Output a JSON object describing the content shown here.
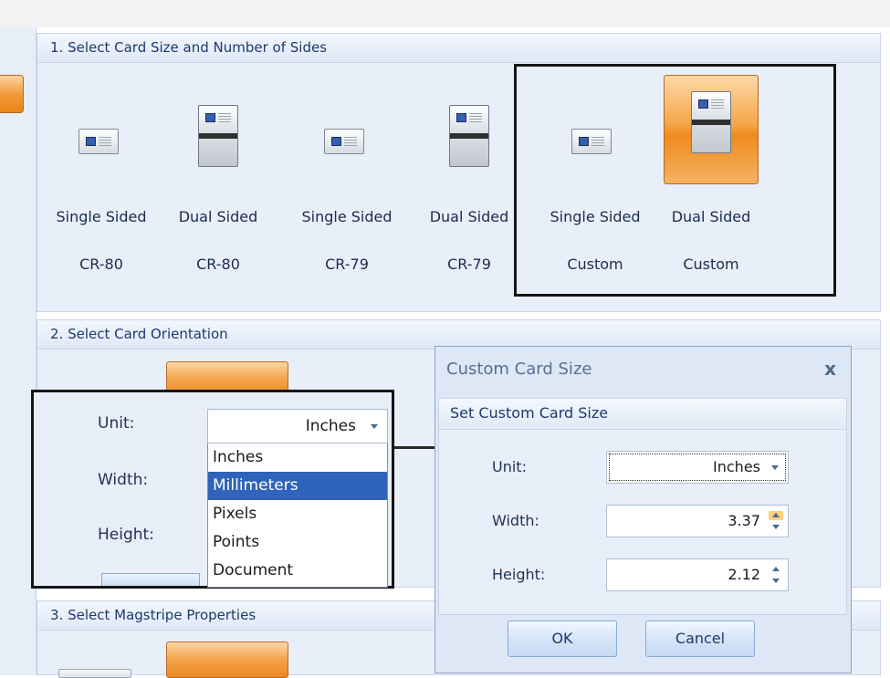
{
  "panels": {
    "card_size_header": "1. Select Card Size and Number of Sides",
    "orientation_header": "2. Select Card Orientation",
    "magstripe_header": "3. Select Magstripe Properties"
  },
  "card_options": [
    {
      "line1": "Single Sided",
      "line2": "CR-80",
      "icon": "single-card-icon"
    },
    {
      "line1": "Dual Sided",
      "line2": "CR-80",
      "icon": "dual-card-icon"
    },
    {
      "line1": "Single Sided",
      "line2": "CR-79",
      "icon": "single-card-icon"
    },
    {
      "line1": "Dual Sided",
      "line2": "CR-79",
      "icon": "dual-card-icon"
    },
    {
      "line1": "Single Sided",
      "line2": "Custom",
      "icon": "single-card-icon"
    },
    {
      "line1": "Dual Sided",
      "line2": "Custom",
      "icon": "dual-card-icon",
      "selected": true
    }
  ],
  "zoom_callout": {
    "unit_label": "Unit:",
    "unit_value": "Inches",
    "width_label": "Width:",
    "height_label": "Height:",
    "options": [
      "Inches",
      "Millimeters",
      "Pixels",
      "Points",
      "Document"
    ],
    "highlighted_option": "Millimeters"
  },
  "dialog": {
    "title": "Custom Card Size",
    "close_glyph": "x",
    "section_header": "Set Custom Card Size",
    "unit_label": "Unit:",
    "unit_value": "Inches",
    "width_label": "Width:",
    "width_value": "3.37",
    "height_label": "Height:",
    "height_value": "2.12",
    "ok_label": "OK",
    "cancel_label": "Cancel"
  },
  "colors": {
    "accent_orange": "#f29a3b",
    "panel_bg": "#e9eff9",
    "header_text": "#1c3a6b",
    "highlight": "#2f64ba"
  }
}
